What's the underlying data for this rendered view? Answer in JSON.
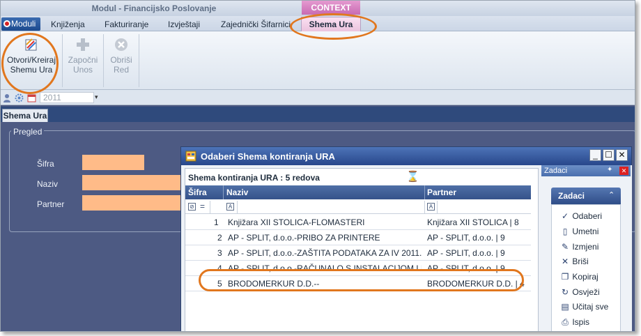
{
  "app": {
    "title": "Modul - Financijsko Poslovanje",
    "context_label": "CONTEXT"
  },
  "ribbon_tabs": [
    "Moduli",
    "Knjiženja",
    "Fakturiranje",
    "Izvještaji",
    "Zajednički Šifarnici",
    "Shema Ura"
  ],
  "ribbon_buttons": {
    "open": {
      "line1": "Otvori/Kreiraj",
      "line2": "Shemu Ura"
    },
    "start": {
      "line1": "Započni",
      "line2": "Unos"
    },
    "delete": {
      "line1": "Obriši",
      "line2": "Red"
    }
  },
  "quick_access": {
    "year": "2011"
  },
  "doc_tab": "Shema Ura",
  "form": {
    "group_title": "Pregled",
    "fields": [
      {
        "label": "Šifra"
      },
      {
        "label": "Naziv"
      },
      {
        "label": "Partner"
      }
    ]
  },
  "dialog": {
    "title": "Odaberi Shema kontiranja URA",
    "grid_caption": "Shema kontiranja URA : 5 redova",
    "columns": [
      "Šifra",
      "Naziv",
      "Partner"
    ],
    "filter": {
      "sifra_op": "="
    },
    "rows": [
      {
        "sifra": "1",
        "naziv": "Knjižara XII STOLICA-FLOMASTERI",
        "partner": "Knjižara XII STOLICA | 8"
      },
      {
        "sifra": "2",
        "naziv": "AP - SPLIT, d.o.o.-PRIBO ZA PRINTERE",
        "partner": "AP - SPLIT, d.o.o. | 9"
      },
      {
        "sifra": "3",
        "naziv": "AP - SPLIT, d.o.o.-ZAŠTITA PODATAKA ZA IV 2011.",
        "partner": "AP - SPLIT, d.o.o. | 9"
      },
      {
        "sifra": "4",
        "naziv": "AP - SPLIT, d.o.o.-RAČUNALO S INSTALACIJOM I UGRA",
        "partner": "AP - SPLIT, d.o.o. | 9"
      },
      {
        "sifra": "5",
        "naziv": "BRODOMERKUR D.D.--",
        "partner": "BRODOMERKUR D.D. | 4"
      }
    ]
  },
  "task_pane": {
    "title": "Zadaci",
    "group_title": "Zadaci",
    "items": [
      "Odaberi",
      "Umetni",
      "Izmjeni",
      "Briši",
      "Kopiraj",
      "Osvježi",
      "Učitaj sve",
      "Ispis"
    ],
    "icons": [
      "check-icon",
      "new-document-icon",
      "edit-icon",
      "delete-x-icon",
      "copy-icon",
      "refresh-icon",
      "load-all-icon",
      "print-icon"
    ]
  },
  "colors": {
    "highlight": "#e1771e",
    "field_fill": "#ffbb88",
    "context_tab": "#d67cc0"
  }
}
